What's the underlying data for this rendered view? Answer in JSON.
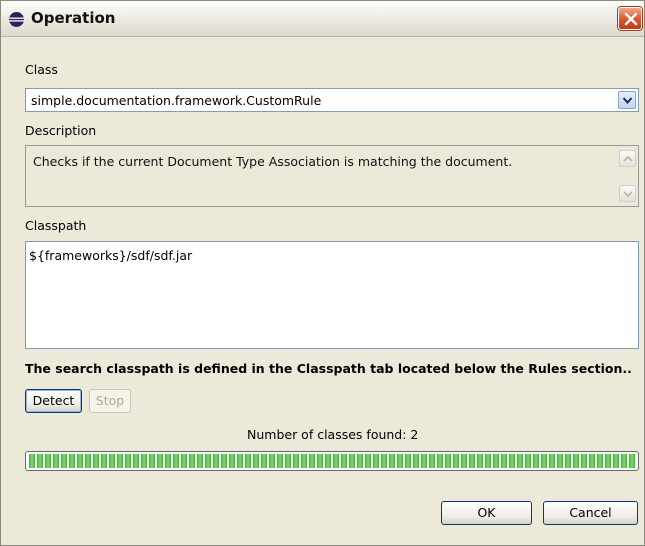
{
  "window": {
    "title": "Operation"
  },
  "class_field": {
    "label": "Class",
    "value": "simple.documentation.framework.CustomRule"
  },
  "description": {
    "label": "Description",
    "text": "Checks if the current Document Type Association is matching the document."
  },
  "classpath": {
    "label": "Classpath",
    "value": "${frameworks}/sdf/sdf.jar"
  },
  "info": {
    "text": "The search classpath is defined in the Classpath tab located below the Rules section.."
  },
  "buttons": {
    "detect": "Detect",
    "stop": "Stop",
    "ok": "OK",
    "cancel": "Cancel"
  },
  "status": {
    "classes_found": "Number of classes found: 2",
    "progress": 1.0
  },
  "icons": {
    "title": "eclipse-icon",
    "close": "close-icon",
    "dropdown": "chevron-down-icon",
    "scroll_up": "scroll-up-icon",
    "scroll_down": "scroll-down-icon"
  },
  "colors": {
    "close_button": "#d9552b",
    "progress_fill": "#3fb33a",
    "dialog_background": "#ece9d8"
  }
}
